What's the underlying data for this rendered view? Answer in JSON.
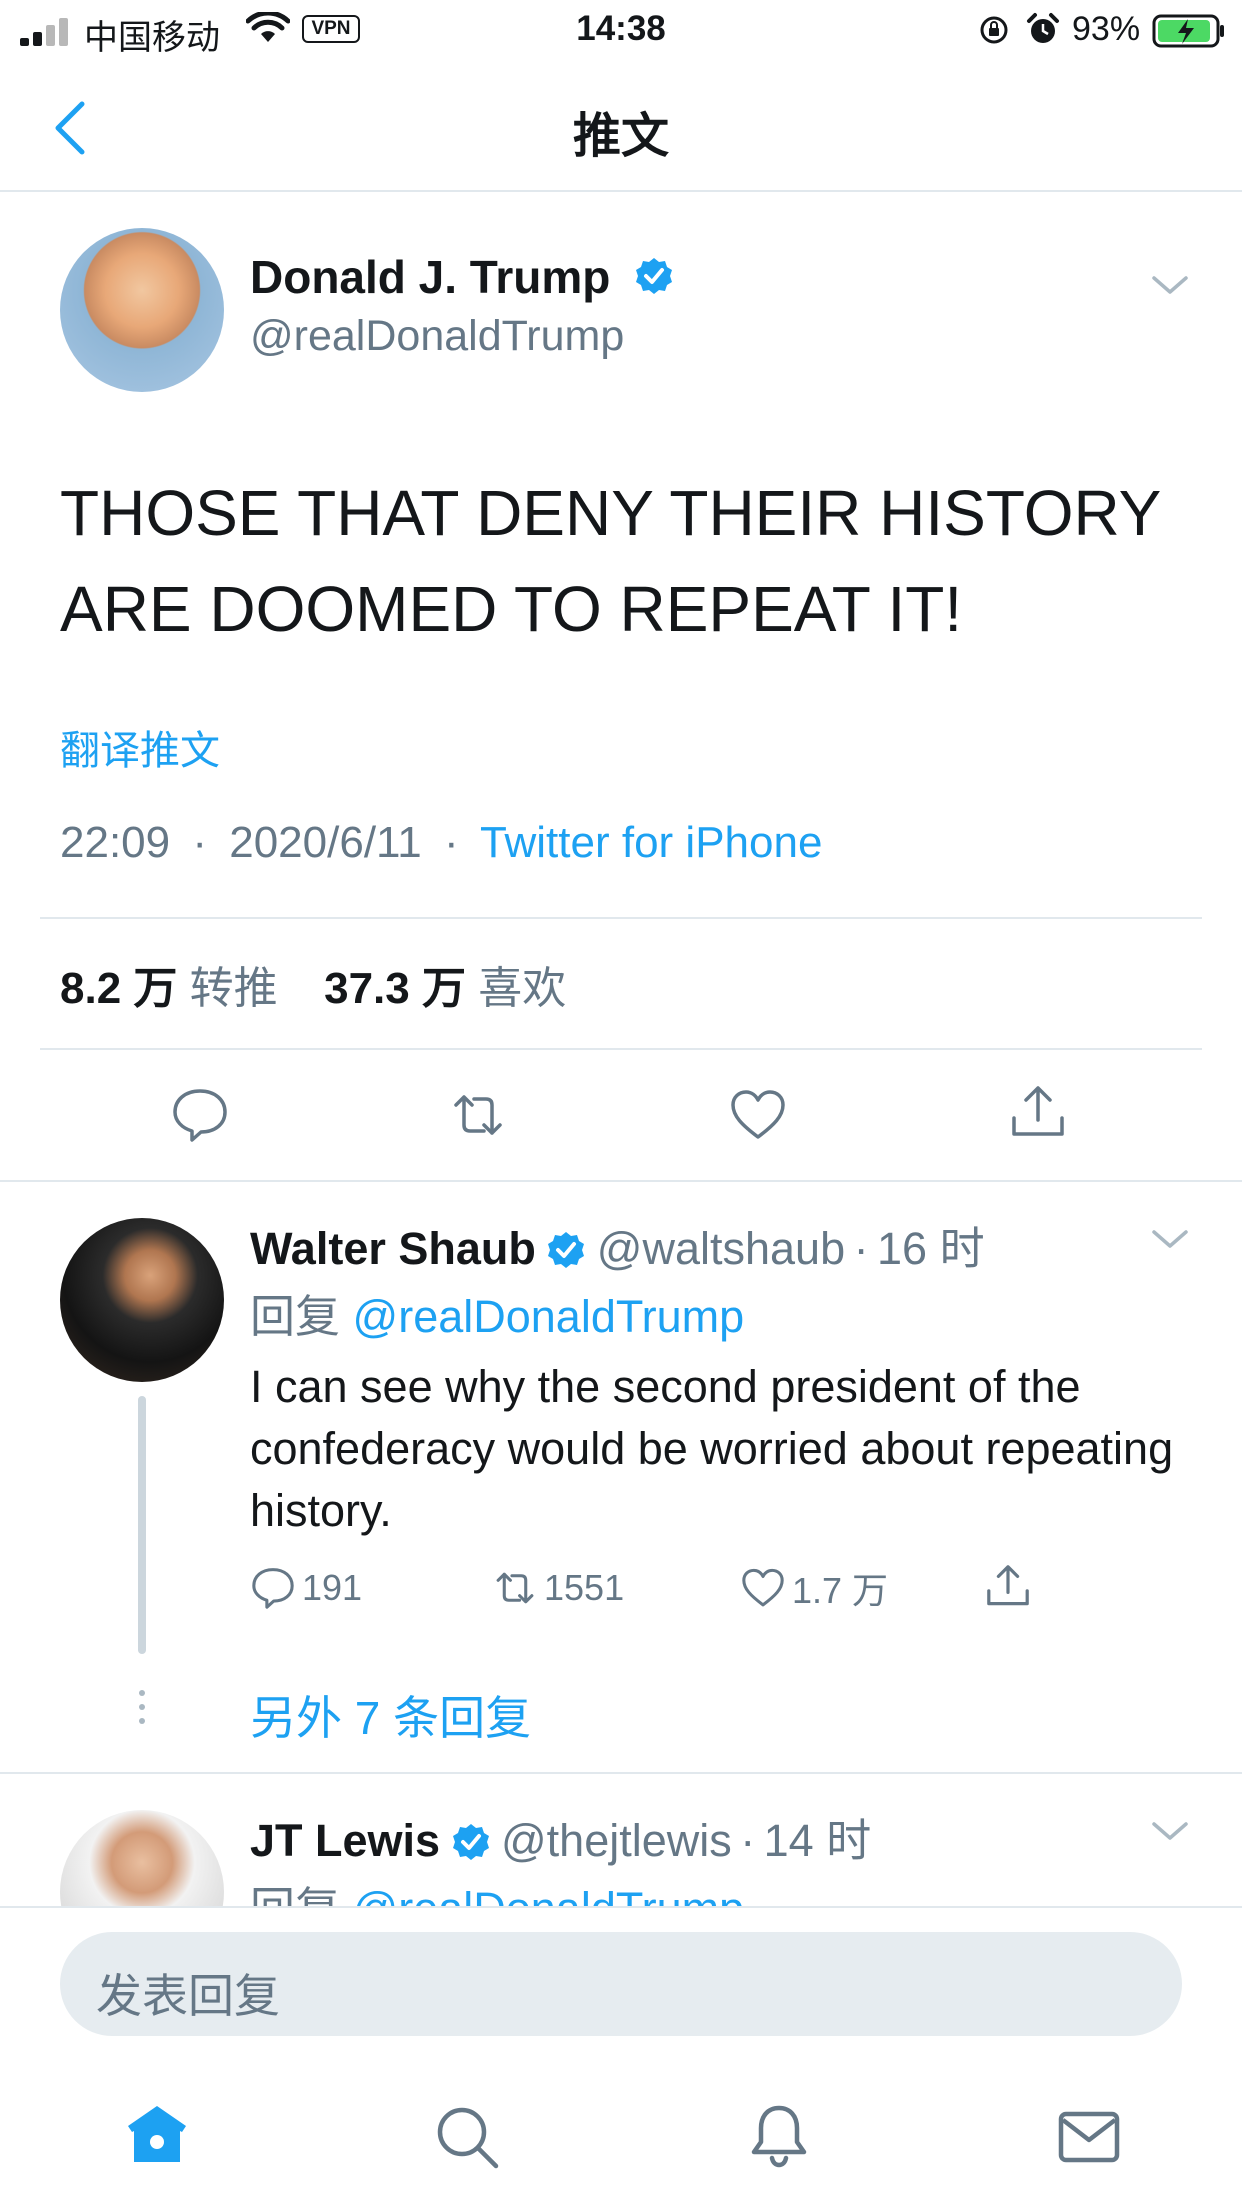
{
  "status_bar": {
    "carrier": "中国移动",
    "vpn": "VPN",
    "time": "14:38",
    "battery": "93%"
  },
  "nav": {
    "title": "推文",
    "back_icon": "chevron-left-icon"
  },
  "tweet": {
    "name": "Donald J. Trump",
    "handle": "@realDonaldTrump",
    "text_line1": "THOSE THAT DENY THEIR HISTORY",
    "text_line2": "ARE DOOMED TO REPEAT IT!",
    "translate": "翻译推文",
    "time": "22:09",
    "sep": "·",
    "date": "2020/6/11",
    "source": "Twitter for iPhone",
    "retweets_count": "8.2 万",
    "retweets_label": "转推",
    "likes_count": "37.3 万",
    "likes_label": "喜欢"
  },
  "replies": [
    {
      "name": "Walter Shaub",
      "handle": "@waltshaub",
      "sep": "·",
      "age": "16 时",
      "reply_prefix": "回复",
      "reply_to": "@realDonaldTrump",
      "text": "I can see why the second president of the confederacy would be worried about repeating history.",
      "replies": "191",
      "retweets": "1551",
      "likes": "1.7 万"
    },
    {
      "name": "JT Lewis",
      "handle": "@thejtlewis",
      "sep": "·",
      "age": "14 时",
      "reply_prefix": "回复",
      "reply_to": "@realDonaldTrump"
    }
  ],
  "more_replies": "另外 7 条回复",
  "composer": {
    "placeholder": "发表回复"
  },
  "colors": {
    "accent": "#1da1f2",
    "secondary_text": "#657786",
    "divider": "#e1e8ed"
  }
}
